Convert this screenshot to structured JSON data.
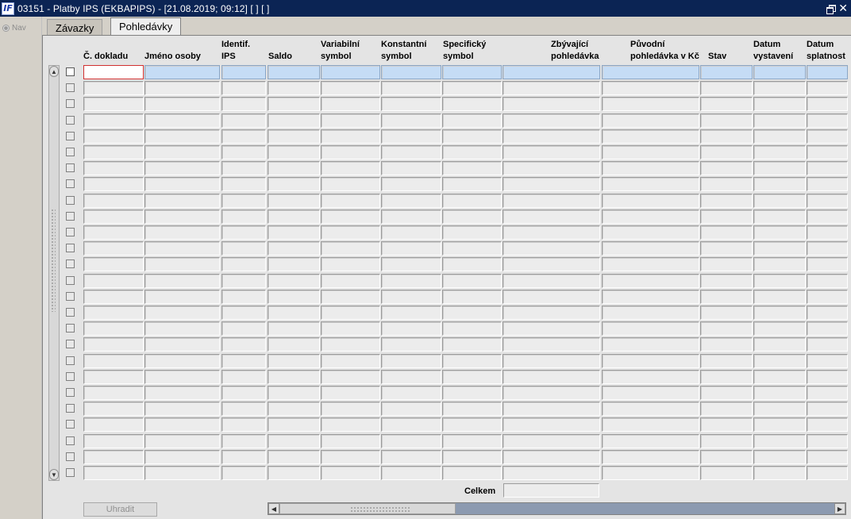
{
  "window": {
    "title": "03151 - Platby IPS (EKBAPIPS) - [21.08.2019; 09:12]  [ ]  [ ]",
    "app_icon": "IF"
  },
  "nav": {
    "label": "Nav"
  },
  "tabs": [
    {
      "label": "Závazky",
      "active": false
    },
    {
      "label": "Pohledávky",
      "active": true
    }
  ],
  "table": {
    "row_count": 26,
    "headers": [
      {
        "key": "doklad",
        "line1": "Č. dokladu",
        "line2": ""
      },
      {
        "key": "jmeno",
        "line1": "Jméno osoby",
        "line2": ""
      },
      {
        "key": "identif",
        "line1": "Identif.",
        "line2": "IPS"
      },
      {
        "key": "saldo",
        "line1": "Saldo",
        "line2": ""
      },
      {
        "key": "vs",
        "line1": "Variabilní",
        "line2": "symbol"
      },
      {
        "key": "ks",
        "line1": "Konstantní",
        "line2": "symbol"
      },
      {
        "key": "ss",
        "line1": "Specifický",
        "line2": "symbol"
      },
      {
        "key": "zbyvajici",
        "line1": "Zbývající",
        "line2": "pohledávka"
      },
      {
        "key": "puvodni",
        "line1": "Původní",
        "line2": "pohledávka v Kč"
      },
      {
        "key": "stav",
        "line1": "Stav",
        "line2": ""
      },
      {
        "key": "vystaveni",
        "line1": "Datum",
        "line2": "vystavení"
      },
      {
        "key": "splatnost",
        "line1": "Datum",
        "line2": "splatnost"
      }
    ]
  },
  "footer": {
    "total_label": "Celkem",
    "total_value": "",
    "pay_button": "Uhradit"
  },
  "colors": {
    "titlebar": "#0b2454",
    "selected_row": "#c5dcf5",
    "focused_border": "#d03030"
  }
}
